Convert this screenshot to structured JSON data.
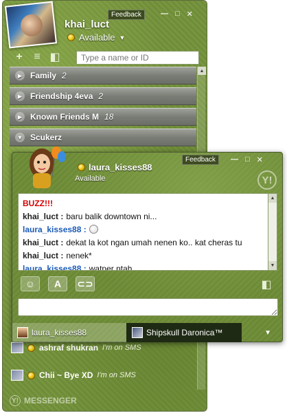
{
  "main": {
    "username": "khai_luct",
    "status": "Available",
    "feedback_label": "Feedback",
    "search_placeholder": "Type a name or ID",
    "groups": [
      {
        "name": "Family",
        "count": "2"
      },
      {
        "name": "Friendship 4eva",
        "count": "2"
      },
      {
        "name": "Known Friends M",
        "count": "18"
      },
      {
        "name": "Scukerz",
        "count": ""
      }
    ],
    "contacts": [
      {
        "name": "ashraf shukran",
        "sub": "I'm on SMS"
      },
      {
        "name": "Chii ~ Bye XD",
        "sub": "I'm on SMS"
      }
    ],
    "brand": "MESSENGER"
  },
  "chat": {
    "buddy_name": "laura_kisses88",
    "buddy_status": "Available",
    "feedback_label": "Feedback",
    "messages": [
      {
        "type": "buzz",
        "text": "BUZZ!!!"
      },
      {
        "type": "self",
        "sender": "khai_luct :",
        "text": "baru balik downtown ni..."
      },
      {
        "type": "other",
        "sender": "laura_kisses88 :",
        "text": ""
      },
      {
        "type": "self",
        "sender": "khai_luct :",
        "text": "dekat la kot ngan umah nenen ko.. kat cheras tu"
      },
      {
        "type": "self",
        "sender": "khai_luct :",
        "text": "nenek*"
      },
      {
        "type": "other",
        "sender": "laura_kisses88 :",
        "text": "watper ntah"
      }
    ],
    "tabs": [
      {
        "label": "laura_kisses88"
      },
      {
        "label": "Shipskull Daronica™"
      }
    ]
  },
  "colors": {
    "skin_green": "#6e8a37",
    "buzz_red": "#d40000",
    "buddy_blue": "#1b5bb8"
  }
}
